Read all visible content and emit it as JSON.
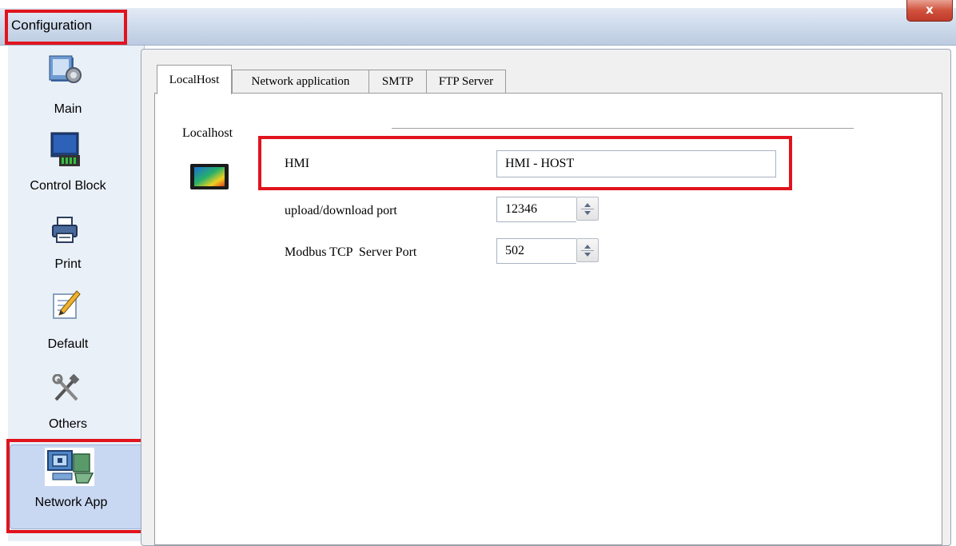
{
  "window": {
    "title": "Configuration",
    "close_label": "x"
  },
  "sidebar": {
    "items": [
      {
        "label": "Main",
        "icon": "main-icon"
      },
      {
        "label": "Control Block",
        "icon": "control-block-icon"
      },
      {
        "label": "Print",
        "icon": "printer-icon"
      },
      {
        "label": "Default",
        "icon": "default-edit-icon"
      },
      {
        "label": "Others",
        "icon": "tools-icon"
      },
      {
        "label": "Network App",
        "icon": "network-app-icon",
        "selected": true
      }
    ]
  },
  "tabs": [
    {
      "label": "LocalHost",
      "active": true
    },
    {
      "label": "Network application"
    },
    {
      "label": "SMTP"
    },
    {
      "label": "FTP Server"
    }
  ],
  "localhost": {
    "group_label": "Localhost",
    "hmi_label": "HMI",
    "hmi_value": "HMI - HOST",
    "upload_label": "upload/download port",
    "upload_value": "12346",
    "modbus_label": "Modbus TCP  Server Port",
    "modbus_value": "502"
  },
  "colors": {
    "highlight_box": "#e0141e",
    "sidebar_selected": "#c9d8f2",
    "close_button": "#c0392b"
  }
}
